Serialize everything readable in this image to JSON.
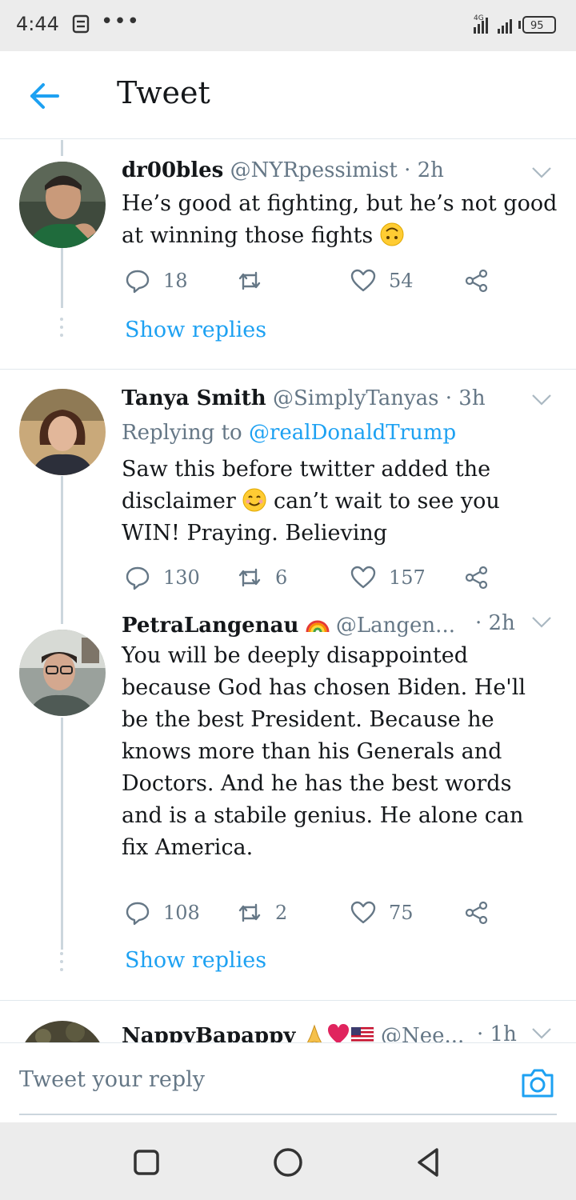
{
  "status_bar": {
    "time": "4:44",
    "network": "4G",
    "battery": "95"
  },
  "header": {
    "title": "Tweet"
  },
  "tweets": [
    {
      "name": "dr00bles",
      "handle": "@NYRpessimist · 2h",
      "body_lines": [
        "He’s good at fighting, but he’s not good",
        "at winning those fights"
      ],
      "emoji": "upside-down-face",
      "replies": "18",
      "retweets": "",
      "likes": "54",
      "show_replies": "Show replies"
    },
    {
      "name": "Tanya Smith",
      "handle": "@SimplyTanyas · 3h",
      "replying_prefix": "Replying to ",
      "replying_to": "@realDonaldTrump",
      "body_lines": [
        "Saw this before twitter added the",
        "disclaimer",
        " can’t wait to see you",
        "WIN! Praying. Believing"
      ],
      "emoji": "smiling-face",
      "replies": "130",
      "retweets": "6",
      "likes": "157"
    },
    {
      "name": "PetraLangenau",
      "handle": "@Langen...",
      "time": "· 2h",
      "emoji": "rainbow",
      "body_lines": [
        "You will be deeply disappointed",
        "because God has chosen Biden. He'll",
        "be the best President. Because he",
        "knows more than his Generals and",
        "Doctors. And he has the best words",
        "and is a stabile genius. He alone can",
        "fix America."
      ],
      "replies": "108",
      "retweets": "2",
      "likes": "75",
      "show_replies": "Show replies"
    },
    {
      "name": "NappyBapappy",
      "handle": "@Nee...",
      "time": "· 1h",
      "emojis": [
        "folded-hands",
        "red-heart",
        "us-flag"
      ]
    }
  ],
  "reply_bar": {
    "placeholder": "Tweet your reply"
  },
  "colors": {
    "accent": "#1da1f2",
    "text": "#14171a",
    "secondary": "#657786",
    "divider": "#e1e8ed"
  }
}
